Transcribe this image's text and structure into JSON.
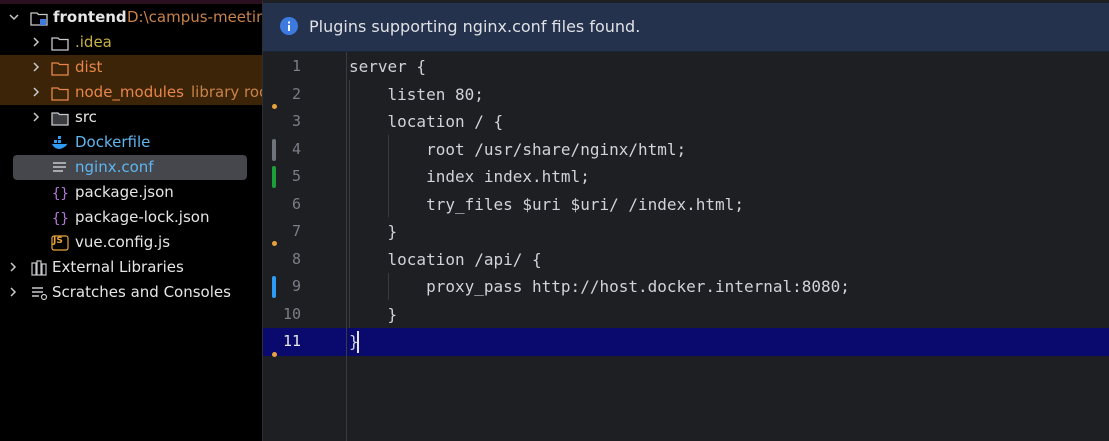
{
  "project_tree": {
    "root": {
      "name": "frontend",
      "path": "D:\\campus-meeting"
    },
    "items": [
      {
        "label": "frontend",
        "extra": "D:\\campus-meeting",
        "icon": "module-folder-icon"
      },
      {
        "label": ".idea",
        "icon": "folder-icon"
      },
      {
        "label": "dist",
        "icon": "folder-icon"
      },
      {
        "label": "node_modules",
        "extra": "library root",
        "icon": "folder-icon"
      },
      {
        "label": "src",
        "icon": "folder-icon"
      },
      {
        "label": "Dockerfile",
        "icon": "docker-icon"
      },
      {
        "label": "nginx.conf",
        "icon": "text-file-icon"
      },
      {
        "label": "package.json",
        "icon": "json-file-icon"
      },
      {
        "label": "package-lock.json",
        "icon": "json-file-icon"
      },
      {
        "label": "vue.config.js",
        "icon": "js-file-icon",
        "badge": "JS"
      },
      {
        "label": "External Libraries",
        "icon": "library-icon"
      },
      {
        "label": "Scratches and Consoles",
        "icon": "scratches-icon"
      }
    ],
    "selected": "nginx.conf"
  },
  "editor": {
    "banner": "Plugins supporting nginx.conf files found.",
    "lines": [
      "server {",
      "    listen 80;",
      "    location / {",
      "        root /usr/share/nginx/html;",
      "        index index.html;",
      "        try_files $uri $uri/ /index.html;",
      "    }",
      "    location /api/ {",
      "        proxy_pass http://host.docker.internal:8080;",
      "    }",
      "}"
    ],
    "line_numbers": [
      "1",
      "2",
      "3",
      "4",
      "5",
      "6",
      "7",
      "8",
      "9",
      "10",
      "11"
    ],
    "current_line": "11"
  },
  "colors": {
    "accent_blue": "#3d7ae0",
    "current_line_bg": "#0a0a6e",
    "excluded_folder_bg": "#3b2408",
    "change_added": "#1e9e3a",
    "change_modified": "#2f9bf5",
    "change_neutral": "#6f737a",
    "marker_dot": "#e8a33d",
    "docker_label": "#5fb6f0"
  }
}
